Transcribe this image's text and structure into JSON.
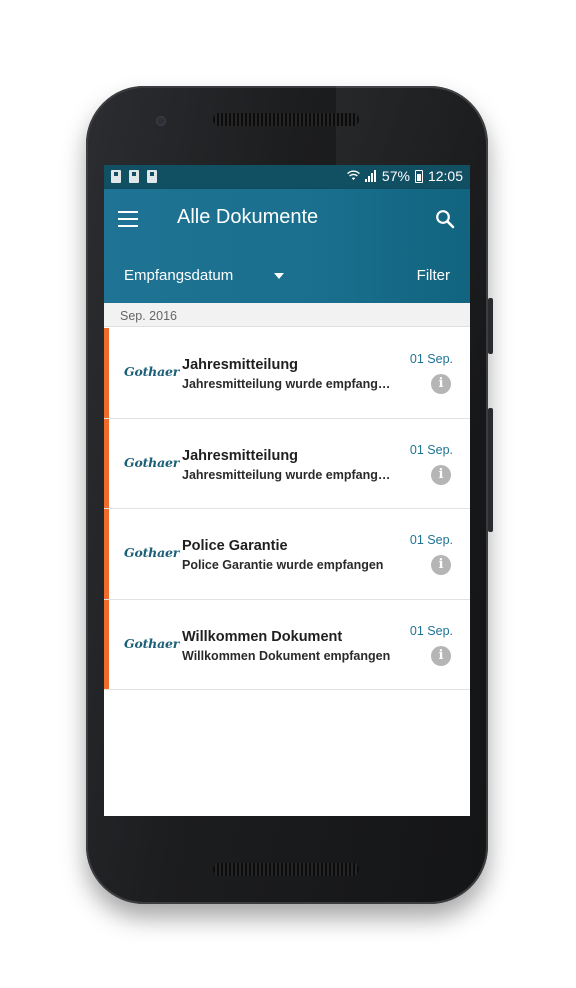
{
  "status_bar": {
    "battery": "57%",
    "time": "12:05",
    "icons": [
      "notification-icon",
      "notification-icon",
      "notification-icon",
      "wifi-icon",
      "signal-icon",
      "battery-icon"
    ]
  },
  "app_bar": {
    "title": "Alle Dokumente",
    "menu_icon": "menu-icon",
    "search_icon": "search-icon",
    "sort_label": "Empfangsdatum",
    "filter_label": "Filter"
  },
  "section": {
    "label": "Sep. 2016"
  },
  "documents": [
    {
      "logo": "Gothaer",
      "title": "Jahresmitteilung",
      "subtitle": "Jahresmitteilung  wurde empfangen",
      "date": "01 Sep.",
      "info": "i"
    },
    {
      "logo": "Gothaer",
      "title": "Jahresmitteilung",
      "subtitle": "Jahresmitteilung  wurde empfangen",
      "date": "01 Sep.",
      "info": "i"
    },
    {
      "logo": "Gothaer",
      "title": "Police Garantie",
      "subtitle": "Police Garantie wurde empfangen",
      "date": "01 Sep.",
      "info": "i"
    },
    {
      "logo": "Gothaer",
      "title": "Willkommen Dokument",
      "subtitle": "Willkommen Dokument empfangen",
      "date": "01 Sep.",
      "info": "i"
    }
  ],
  "colors": {
    "app_bar": "#1b7190",
    "status_bar": "#114f63",
    "accent_stripe": "#ef6b2b",
    "date_text": "#1f7394"
  }
}
